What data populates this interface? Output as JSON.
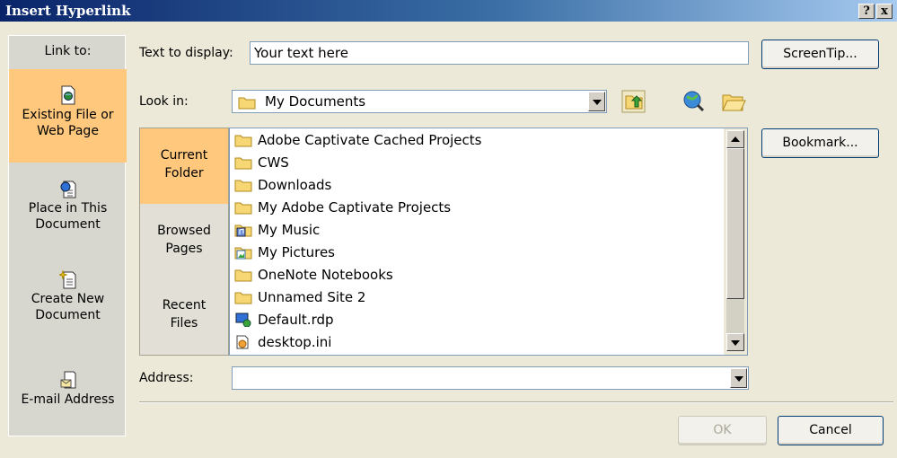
{
  "window": {
    "title": "Insert Hyperlink",
    "help_button": "?",
    "close_button": "x"
  },
  "link_to": {
    "label": "Link to:",
    "items": [
      {
        "line1": "Existing File or",
        "line2": "Web Page",
        "selected": true,
        "icon": "existing-file-icon"
      },
      {
        "line1": "Place in This",
        "line2": "Document",
        "selected": false,
        "icon": "place-in-document-icon"
      },
      {
        "line1": "Create New",
        "line2": "Document",
        "selected": false,
        "icon": "create-new-document-icon"
      },
      {
        "line1": "E-mail Address",
        "line2": "",
        "selected": false,
        "icon": "email-address-icon"
      }
    ]
  },
  "text_to_display": {
    "label": "Text to display:",
    "value": "Your text here"
  },
  "buttons": {
    "screentip": "ScreenTip...",
    "bookmark": "Bookmark...",
    "ok": "OK",
    "cancel": "Cancel"
  },
  "look_in": {
    "label": "Look in:",
    "value": "My Documents"
  },
  "browse_tabs": [
    {
      "line1": "Current",
      "line2": "Folder",
      "selected": true
    },
    {
      "line1": "Browsed",
      "line2": "Pages",
      "selected": false
    },
    {
      "line1": "Recent",
      "line2": "Files",
      "selected": false
    }
  ],
  "files": [
    {
      "name": "Adobe Captivate Cached Projects",
      "icon": "folder-icon"
    },
    {
      "name": "CWS",
      "icon": "folder-icon"
    },
    {
      "name": "Downloads",
      "icon": "folder-icon"
    },
    {
      "name": "My Adobe Captivate Projects",
      "icon": "folder-icon"
    },
    {
      "name": "My Music",
      "icon": "music-folder-icon"
    },
    {
      "name": "My Pictures",
      "icon": "pictures-folder-icon"
    },
    {
      "name": "OneNote Notebooks",
      "icon": "folder-icon"
    },
    {
      "name": "Unnamed Site 2",
      "icon": "folder-icon"
    },
    {
      "name": "Default.rdp",
      "icon": "rdp-file-icon"
    },
    {
      "name": "desktop.ini",
      "icon": "ini-file-icon"
    }
  ],
  "address": {
    "label": "Address:",
    "value": ""
  },
  "colors": {
    "selected_bg": "#ffc87c",
    "dialog_bg": "#ece9d8",
    "title_blue": "#0a246a"
  }
}
